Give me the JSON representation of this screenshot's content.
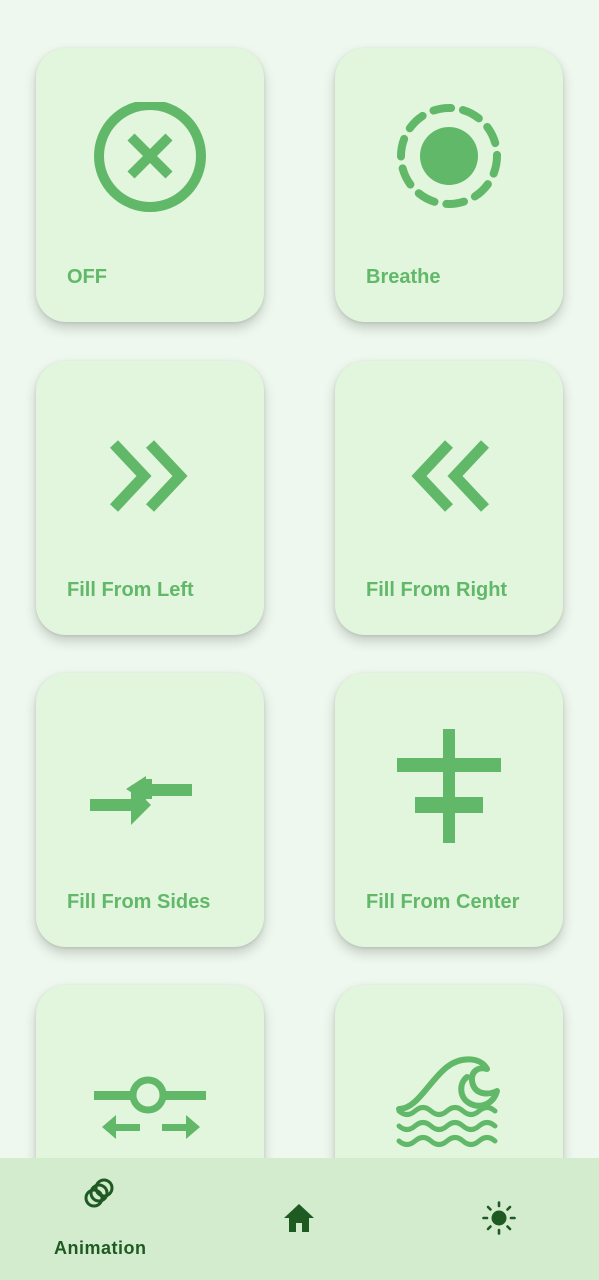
{
  "modes": [
    {
      "label": "OFF",
      "icon": "off-circle-x-icon"
    },
    {
      "label": "Breathe",
      "icon": "breathe-icon"
    },
    {
      "label": "Fill From Left",
      "icon": "double-chevron-right-icon"
    },
    {
      "label": "Fill From Right",
      "icon": "double-chevron-left-icon"
    },
    {
      "label": "Fill From Sides",
      "icon": "arrows-inward-icon"
    },
    {
      "label": "Fill From Center",
      "icon": "center-bars-icon"
    },
    {
      "label": "",
      "icon": "slider-arrows-icon"
    },
    {
      "label": "",
      "icon": "wave-icon"
    }
  ],
  "colors": {
    "background": "#eef8ee",
    "card": "#e2f6de",
    "accent": "#62b869",
    "nav_background": "#d2eccd",
    "nav_active": "#1e5a22"
  },
  "bottom_nav": {
    "items": [
      {
        "label": "Animation",
        "icon": "animation-rings-icon",
        "active": true
      },
      {
        "label": "",
        "icon": "home-icon",
        "active": false
      },
      {
        "label": "",
        "icon": "brightness-icon",
        "active": false
      }
    ]
  }
}
